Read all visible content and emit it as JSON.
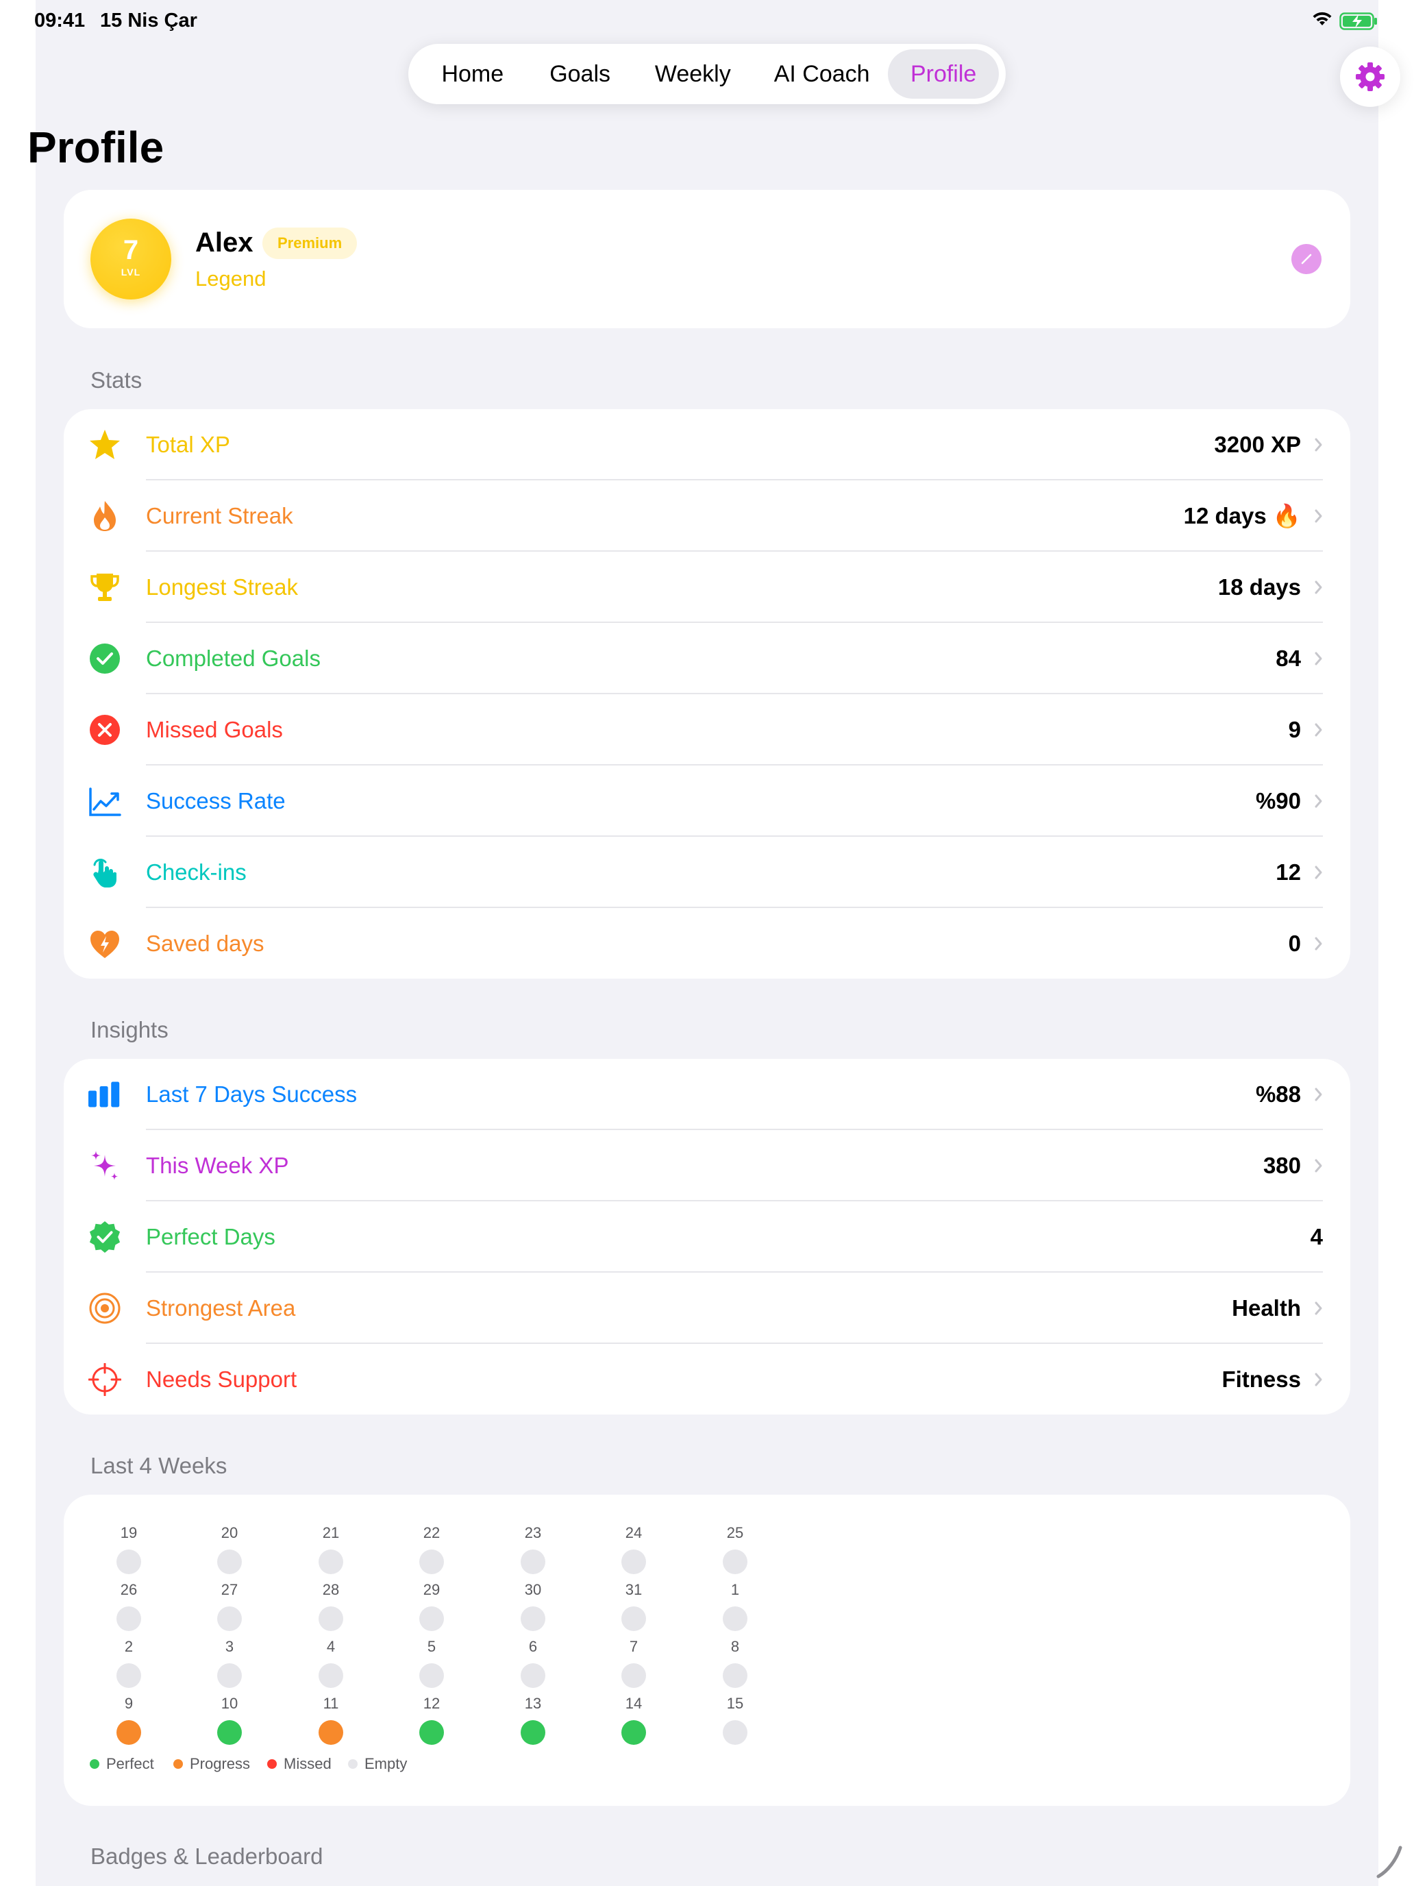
{
  "status_bar": {
    "time": "09:41",
    "date": "15 Nis Çar"
  },
  "tabs": [
    {
      "label": "Home",
      "active": false
    },
    {
      "label": "Goals",
      "active": false
    },
    {
      "label": "Weekly",
      "active": false
    },
    {
      "label": "AI Coach",
      "active": false
    },
    {
      "label": "Profile",
      "active": true
    }
  ],
  "page_title": "Profile",
  "profile": {
    "level": "7",
    "level_label": "LVL",
    "name": "Alex",
    "badge": "Premium",
    "rank": "Legend"
  },
  "stats": {
    "header": "Stats",
    "rows": [
      {
        "icon": "star-icon",
        "label": "Total XP",
        "value": "3200 XP",
        "color": "#f5c400"
      },
      {
        "icon": "flame-icon",
        "label": "Current Streak",
        "value": "12 days 🔥",
        "color": "#f7892b"
      },
      {
        "icon": "trophy-icon",
        "label": "Longest Streak",
        "value": "18 days",
        "color": "#f5c400"
      },
      {
        "icon": "checkmark-circle-icon",
        "label": "Completed Goals",
        "value": "84",
        "color": "#34c759"
      },
      {
        "icon": "x-circle-icon",
        "label": "Missed Goals",
        "value": "9",
        "color": "#ff3b30"
      },
      {
        "icon": "trend-chart-icon",
        "label": "Success Rate",
        "value": "%90",
        "color": "#0a84ff"
      },
      {
        "icon": "tap-hand-icon",
        "label": "Check-ins",
        "value": "12",
        "color": "#00c7be"
      },
      {
        "icon": "heart-bolt-icon",
        "label": "Saved days",
        "value": "0",
        "color": "#f7892b"
      }
    ]
  },
  "insights": {
    "header": "Insights",
    "rows": [
      {
        "icon": "bar-chart-icon",
        "label": "Last 7 Days Success",
        "value": "%88",
        "color": "#0a84ff",
        "chevron": true
      },
      {
        "icon": "sparkles-icon",
        "label": "This Week XP",
        "value": "380",
        "color": "#c030d6",
        "chevron": true
      },
      {
        "icon": "seal-check-icon",
        "label": "Perfect Days",
        "value": "4",
        "color": "#34c759",
        "chevron": false
      },
      {
        "icon": "target-icon",
        "label": "Strongest Area",
        "value": "Health",
        "color": "#f7892b",
        "chevron": true
      },
      {
        "icon": "crosshair-icon",
        "label": "Needs Support",
        "value": "Fitness",
        "color": "#ff3b30",
        "chevron": true
      }
    ]
  },
  "last_4_weeks": {
    "header": "Last 4 Weeks",
    "weeks": [
      [
        {
          "day": "19",
          "status": "empty"
        },
        {
          "day": "20",
          "status": "empty"
        },
        {
          "day": "21",
          "status": "empty"
        },
        {
          "day": "22",
          "status": "empty"
        },
        {
          "day": "23",
          "status": "empty"
        },
        {
          "day": "24",
          "status": "empty"
        },
        {
          "day": "25",
          "status": "empty"
        }
      ],
      [
        {
          "day": "26",
          "status": "empty"
        },
        {
          "day": "27",
          "status": "empty"
        },
        {
          "day": "28",
          "status": "empty"
        },
        {
          "day": "29",
          "status": "empty"
        },
        {
          "day": "30",
          "status": "empty"
        },
        {
          "day": "31",
          "status": "empty"
        },
        {
          "day": "1",
          "status": "empty"
        }
      ],
      [
        {
          "day": "2",
          "status": "empty"
        },
        {
          "day": "3",
          "status": "empty"
        },
        {
          "day": "4",
          "status": "empty"
        },
        {
          "day": "5",
          "status": "empty"
        },
        {
          "day": "6",
          "status": "empty"
        },
        {
          "day": "7",
          "status": "empty"
        },
        {
          "day": "8",
          "status": "empty"
        }
      ],
      [
        {
          "day": "9",
          "status": "progress"
        },
        {
          "day": "10",
          "status": "perfect"
        },
        {
          "day": "11",
          "status": "progress"
        },
        {
          "day": "12",
          "status": "perfect"
        },
        {
          "day": "13",
          "status": "perfect"
        },
        {
          "day": "14",
          "status": "perfect"
        },
        {
          "day": "15",
          "status": "empty"
        }
      ]
    ],
    "legend": [
      {
        "key": "perfect",
        "label": "Perfect",
        "color": "#34c759"
      },
      {
        "key": "progress",
        "label": "Progress",
        "color": "#f7892b"
      },
      {
        "key": "missed",
        "label": "Missed",
        "color": "#ff3b30"
      },
      {
        "key": "empty",
        "label": "Empty",
        "color": "#e6e6ea"
      }
    ]
  },
  "badges_section": {
    "header": "Badges & Leaderboard"
  },
  "colors": {
    "accent": "#c030d6",
    "gold": "#f5c400",
    "background": "#f2f2f7"
  }
}
